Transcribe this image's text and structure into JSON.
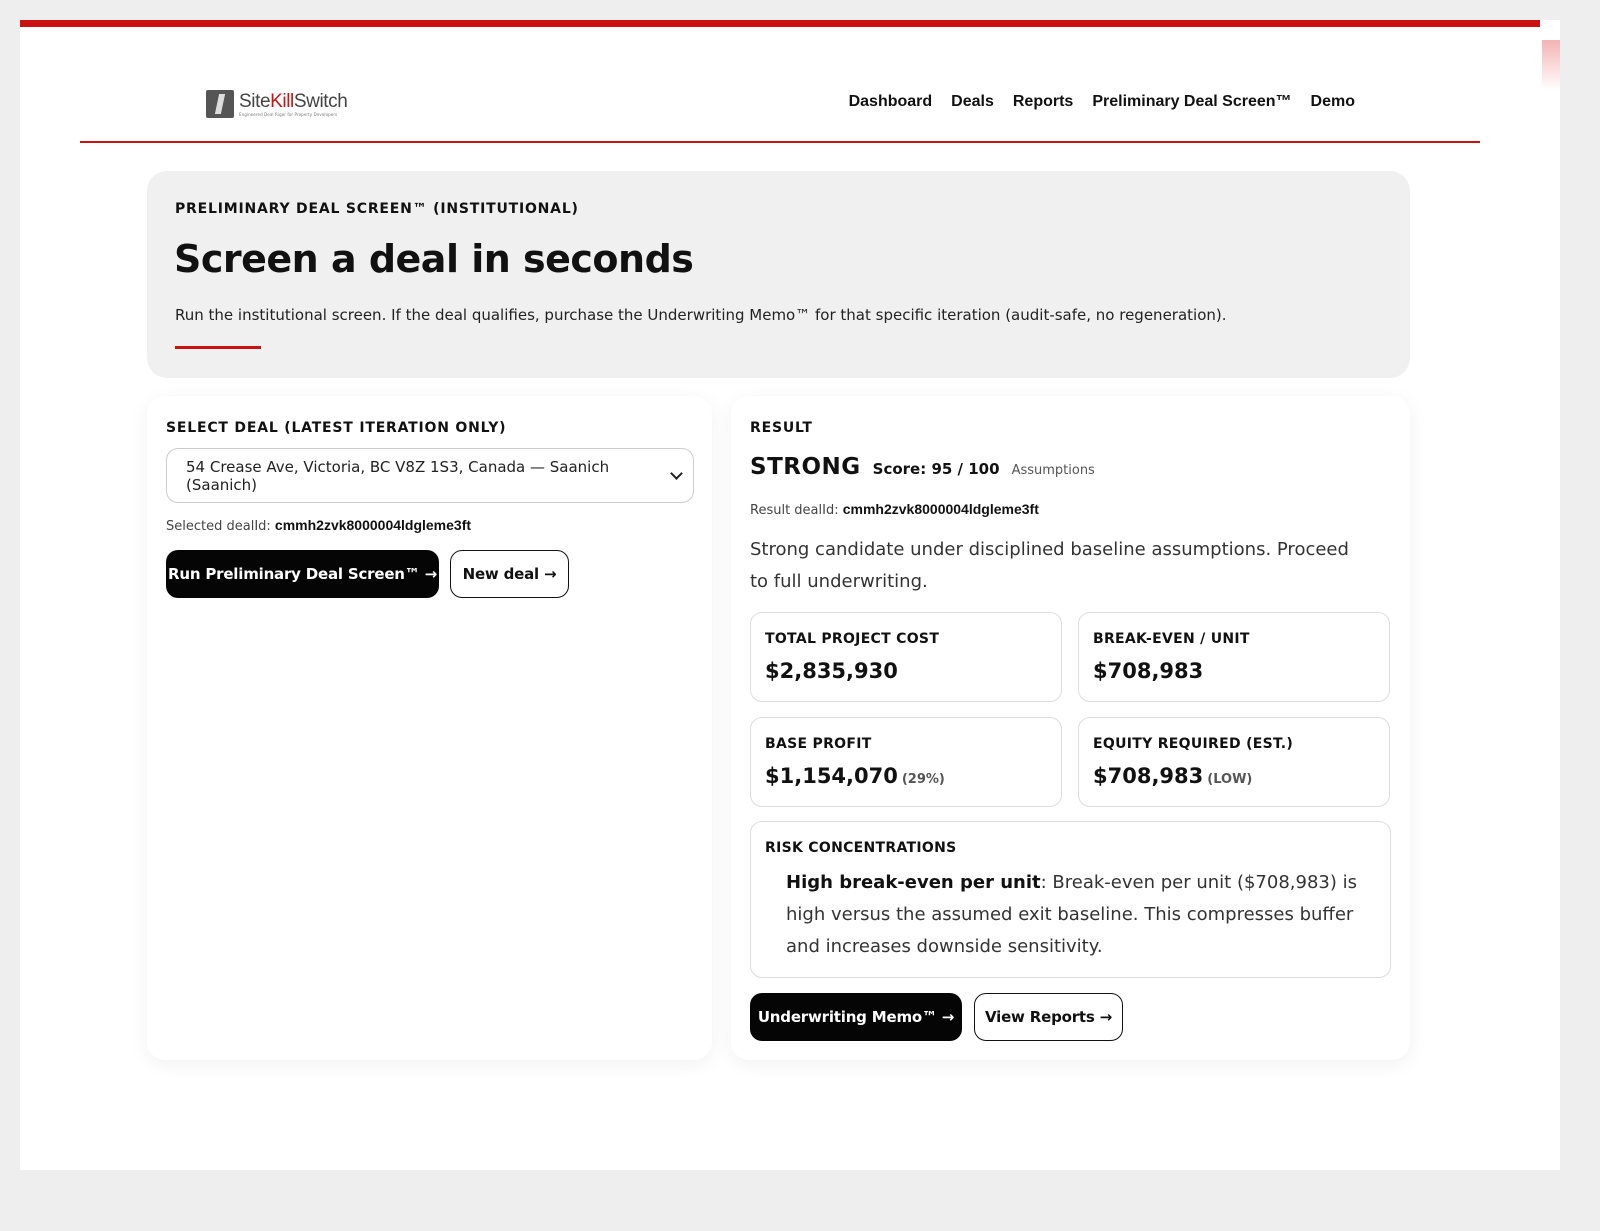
{
  "brand": {
    "name_part1": "Site",
    "name_part2": "Kill",
    "name_part3": "Switch",
    "tagline": "Engineered Deal Rigor for Property Developers",
    "accent_color": "#cc1111"
  },
  "nav": {
    "items": [
      "Dashboard",
      "Deals",
      "Reports",
      "Preliminary Deal Screen™",
      "Demo"
    ]
  },
  "hero": {
    "eyebrow": "PRELIMINARY DEAL SCREEN™ (INSTITUTIONAL)",
    "title": "Screen a deal in seconds",
    "description": "Run the institutional screen. If the deal qualifies, purchase the Underwriting Memo™ for that specific iteration (audit-safe, no regeneration)."
  },
  "select_deal": {
    "label": "SELECT DEAL (LATEST ITERATION ONLY)",
    "selected_value": "54 Crease Ave, Victoria, BC V8Z 1S3, Canada — Saanich (Saanich)",
    "selected_id_label": "Selected dealId:",
    "selected_id": "cmmh2zvk8000004ldgleme3ft",
    "run_button": "Run Preliminary Deal Screen™ →",
    "new_button": "New deal →"
  },
  "result": {
    "label": "RESULT",
    "status": "STRONG",
    "score": "Score: 95 / 100",
    "assumptions_link": "Assumptions",
    "result_id_label": "Result dealId:",
    "result_id": "cmmh2zvk8000004ldgleme3ft",
    "summary": "Strong candidate under disciplined baseline assumptions. Proceed to full underwriting.",
    "metrics": [
      {
        "label": "TOTAL PROJECT COST",
        "value": "$2,835,930",
        "note": ""
      },
      {
        "label": "BREAK-EVEN / UNIT",
        "value": "$708,983",
        "note": ""
      },
      {
        "label": "BASE PROFIT",
        "value": "$1,154,070",
        "note": "(29%)"
      },
      {
        "label": "EQUITY REQUIRED (EST.)",
        "value": "$708,983",
        "note": "(LOW)"
      }
    ],
    "risk": {
      "label": "RISK CONCENTRATIONS",
      "title": "High break-even per unit",
      "text": ": Break-even per unit ($708,983) is high versus the assumed exit baseline. This compresses buffer and increases downside sensitivity."
    },
    "memo_button": "Underwriting Memo™ →",
    "reports_button": "View Reports →"
  }
}
